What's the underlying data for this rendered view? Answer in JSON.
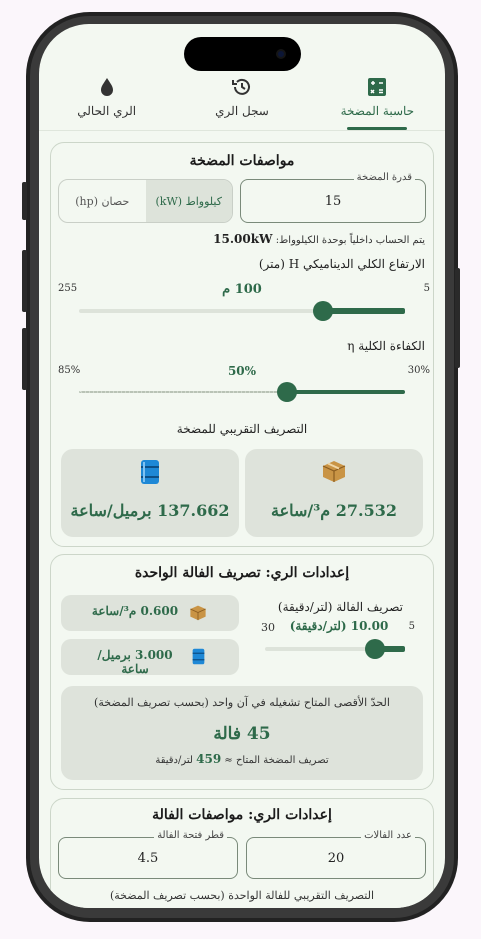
{
  "tabs": [
    {
      "label": "حاسبة المضخة",
      "icon": "calculator-icon",
      "active": true
    },
    {
      "label": "سجل الري",
      "icon": "history-icon",
      "active": false
    },
    {
      "label": "الري الحالي",
      "icon": "water-drop-icon",
      "active": false
    }
  ],
  "pump": {
    "title": "مواصفات المضخة",
    "power_label": "قدرة المضخة",
    "power_value": "15",
    "unit_kw": "كيلوواط (kW)",
    "unit_hp": "حصان (hp)",
    "kw_note": "يتم الحساب داخلياً بوحدة الكيلوواط:",
    "kw_value": "15.00kW",
    "head_label": "الارتفاع الكلي الديناميكي H (متر)",
    "head_min": "5",
    "head_max": "255",
    "head_value": "100 م",
    "head_fraction": 0.38,
    "eff_label": "الكفاءة الكلية η",
    "eff_min": "30%",
    "eff_max": "85%",
    "eff_value": "50%",
    "eff_fraction": 0.36,
    "flow_title": "التصريف التقريبي للمضخة",
    "flow_m3": "27.532 م³/ساعة",
    "flow_bbl": "137.662 برميل/ساعة"
  },
  "valve": {
    "title": "إعدادات الري: تصريف الفالة الواحدة",
    "flow_label": "تصريف الفالة (لتر/دقيقة)",
    "flow_value": "10.00 (لتر/دقيقة)",
    "flow_min": "5",
    "flow_max": "30",
    "flow_fraction": 0.2,
    "m3_value": "0.600 م³/ساعة",
    "bbl_value": "3.000 برميل/ساعة",
    "max_title": "الحدّ الأقصى المتاح تشغيله في آن واحد (بحسب تصريف المضخة)",
    "max_value": "45 فالة",
    "pump_note_prefix": "تصريف المضخة المتاح ≈",
    "pump_note_value": "459",
    "pump_note_suffix": "لتر/دقيقة"
  },
  "valve_spec": {
    "title": "إعدادات الري: مواصفات الفالة",
    "count_label": "عدد الفالات",
    "count_value": "20",
    "diameter_label": "قطر فتحة الفالة",
    "diameter_value": "4.5",
    "approx_note": "التصريف التقريبي للفالة الواحدة (بحسب تصريف المضخة)"
  },
  "colors": {
    "accent": "#2e6a4a",
    "oil_blue": "#1e88d6",
    "box_brown": "#c08a3c"
  }
}
